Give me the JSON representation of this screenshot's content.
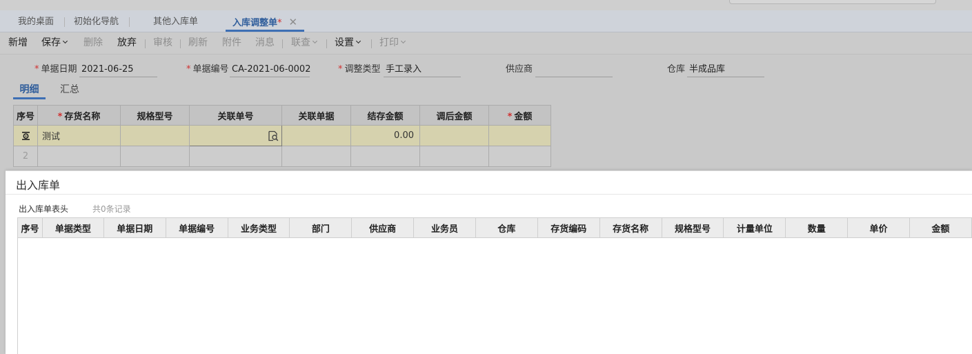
{
  "tabs": [
    {
      "label": "我的桌面"
    },
    {
      "label": "初始化导航"
    },
    {
      "label": "其他入库单"
    },
    {
      "label": "入库调整单",
      "modified_mark": "*",
      "close": "✕"
    }
  ],
  "toolbar": {
    "new": "新增",
    "save": "保存",
    "delete": "删除",
    "discard": "放弃",
    "audit": "审核",
    "refresh": "刷新",
    "attachment": "附件",
    "message": "消息",
    "link_query": "联查",
    "settings": "设置",
    "print": "打印"
  },
  "form": {
    "required_mark": "*",
    "date_label": "单据日期",
    "date_value": "2021-06-25",
    "number_label": "单据编号",
    "number_value": "CA-2021-06-0002",
    "adjust_type_label": "调整类型",
    "adjust_type_value": "手工录入",
    "supplier_label": "供应商",
    "supplier_value": "",
    "warehouse_label": "仓库",
    "warehouse_value": "半成品库"
  },
  "detail_tabs": {
    "detail": "明细",
    "summary": "汇总"
  },
  "grid": {
    "headers": {
      "idx": "序号",
      "name": "存货名称",
      "spec": "规格型号",
      "link_no": "关联单号",
      "link_doc": "关联单据",
      "closing_amount": "结存金额",
      "adjusted_amount": "调后金额",
      "amount": "金额"
    },
    "rows": [
      {
        "idx": "",
        "name": "测试",
        "spec": "",
        "link_no": "",
        "link_doc": "",
        "closing_amount": "0.00",
        "adjusted_amount": "",
        "amount": ""
      },
      {
        "idx": "2",
        "name": "",
        "spec": "",
        "link_no": "",
        "link_doc": "",
        "closing_amount": "",
        "adjusted_amount": "",
        "amount": ""
      }
    ]
  },
  "modal": {
    "title": "出入库单",
    "section_label": "出入库单表头",
    "record_count": "共0条记录",
    "columns": [
      "序号",
      "单据类型",
      "单据日期",
      "单据编号",
      "业务类型",
      "部门",
      "供应商",
      "业务员",
      "仓库",
      "存货编码",
      "存货名称",
      "规格型号",
      "计量单位",
      "数量",
      "单价",
      "金额"
    ]
  },
  "colors": {
    "accent": "#3d6fb4",
    "required": "#d03030",
    "selected_row": "#d6d2ae"
  }
}
